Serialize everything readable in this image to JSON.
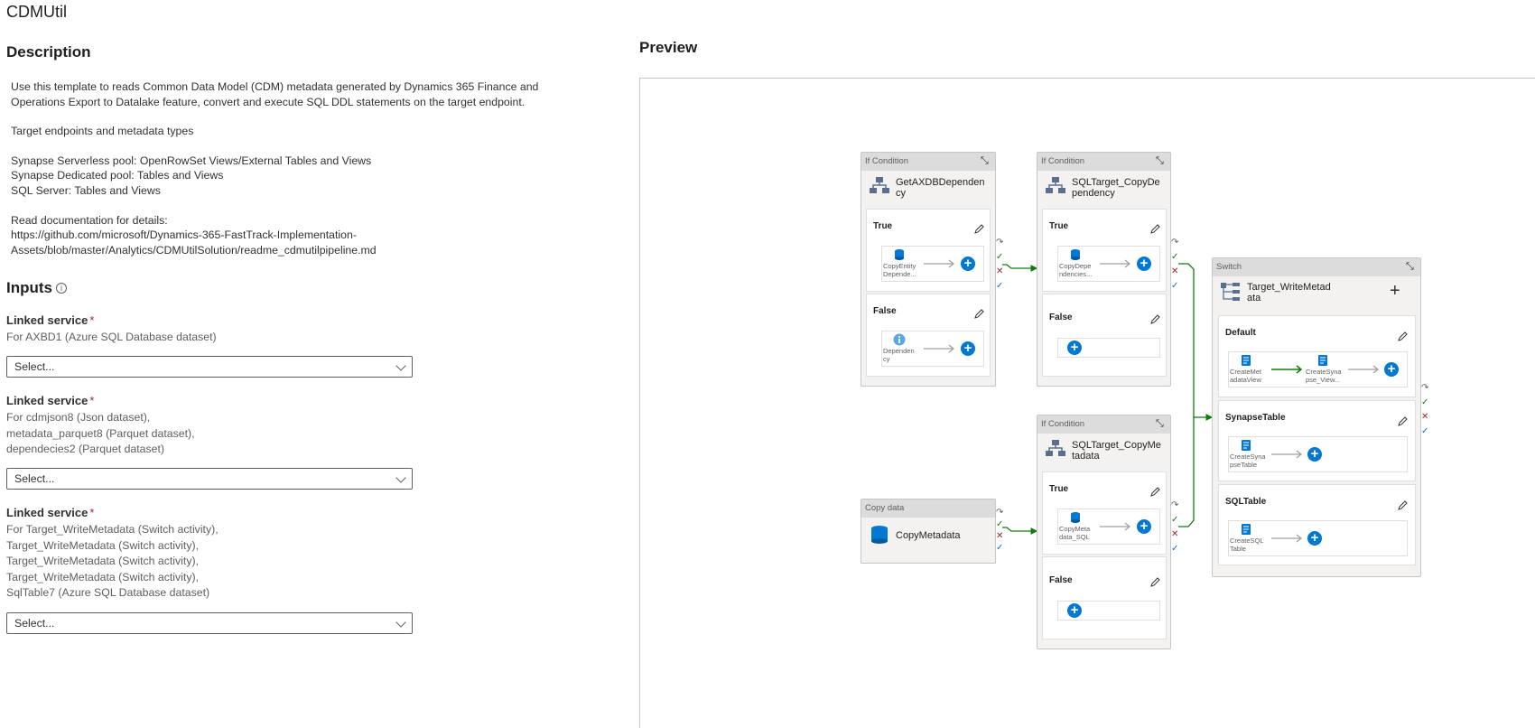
{
  "page": {
    "title": "CDMUtil"
  },
  "description": {
    "heading": "Description",
    "lines": [
      "Use this template to reads Common Data Model (CDM) metadata generated by Dynamics 365 Finance and",
      "Operations Export to Datalake feature, convert and execute SQL DDL statements on the target endpoint.",
      "",
      "Target endpoints and metadata types",
      "",
      "Synapse Serverless pool: OpenRowSet Views/External Tables and Views",
      "Synapse Dedicated pool: Tables and Views",
      "SQL Server: Tables and Views",
      "",
      "Read documentation for details:",
      "https://github.com/microsoft/Dynamics-365-FastTrack-Implementation-",
      "Assets/blob/master/Analytics/CDMUtilSolution/readme_cdmutilpipeline.md"
    ]
  },
  "inputs": {
    "heading": "Inputs",
    "info_icon": "info-icon",
    "linked_services": [
      {
        "label": "Linked service",
        "required": "*",
        "desc": [
          "For AXBD1 (Azure SQL Database dataset)"
        ],
        "select_value": "Select..."
      },
      {
        "label": "Linked service",
        "required": "*",
        "desc": [
          "For cdmjson8 (Json dataset),",
          "metadata_parquet8 (Parquet dataset),",
          "dependecies2 (Parquet dataset)"
        ],
        "select_value": "Select..."
      },
      {
        "label": "Linked service",
        "required": "*",
        "desc": [
          "For Target_WriteMetadata (Switch activity),",
          "Target_WriteMetadata (Switch activity),",
          "Target_WriteMetadata (Switch activity),",
          "Target_WriteMetadata (Switch activity),",
          "SqlTable7 (Azure SQL Database dataset)"
        ],
        "select_value": "Select..."
      }
    ]
  },
  "preview": {
    "heading": "Preview",
    "nodes": {
      "if1": {
        "type": "If Condition",
        "title_lines": [
          "GetAXDBDependen",
          "cy"
        ],
        "true_label": "True",
        "true_activity": [
          "CopyEntity",
          "Depende..."
        ],
        "false_label": "False",
        "false_activity": [
          "Dependen",
          "cy"
        ]
      },
      "if2": {
        "type": "If Condition",
        "title_lines": [
          "SQLTarget_CopyDe",
          "pendency"
        ],
        "true_label": "True",
        "true_activity": [
          "CopyDepe",
          "ndencies..."
        ],
        "false_label": "False"
      },
      "if3": {
        "type": "If Condition",
        "title_lines": [
          "SQLTarget_CopyMe",
          "tadata"
        ],
        "true_label": "True",
        "true_activity": [
          "CopyMeta",
          "data_SQL"
        ],
        "false_label": "False"
      },
      "copy": {
        "type": "Copy data",
        "title": "CopyMetadata"
      },
      "switch": {
        "type": "Switch",
        "title_lines": [
          "Target_WriteMetad",
          "ata"
        ],
        "cases": [
          {
            "label": "Default",
            "activities": [
              [
                "CreateMet",
                "adataView"
              ],
              [
                "CreateSyna",
                "pse_View..."
              ]
            ]
          },
          {
            "label": "SynapseTable",
            "activities": [
              [
                "CreateSyna",
                "pseTable"
              ]
            ]
          },
          {
            "label": "SQLTable",
            "activities": [
              [
                "CreateSQL",
                "Table"
              ]
            ]
          }
        ]
      }
    },
    "colors": {
      "accent": "#0078d4",
      "success": "#107c10",
      "fail": "#a4262c",
      "header_bg": "#dcdcdc"
    }
  }
}
